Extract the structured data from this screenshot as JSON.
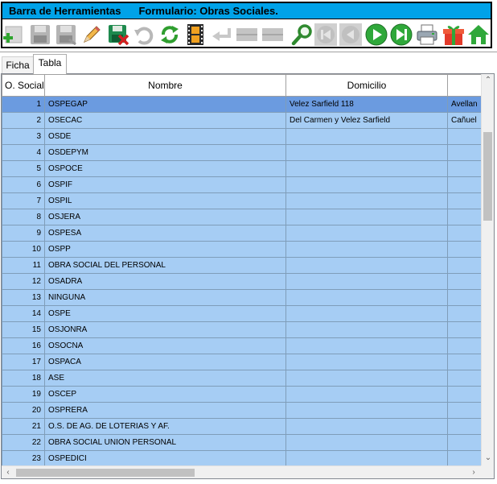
{
  "toolbar": {
    "title_left": "Barra de Herramientas",
    "title_right": "Formulario: Obras Sociales.",
    "title_color": "#00a2e8",
    "buttons": [
      {
        "icon": "add-icon",
        "enabled": true
      },
      {
        "icon": "save-icon",
        "enabled": false
      },
      {
        "icon": "save-as-icon",
        "enabled": false
      },
      {
        "icon": "edit-pencil-icon",
        "enabled": true
      },
      {
        "icon": "delete-save-icon",
        "enabled": true
      },
      {
        "icon": "undo-icon",
        "enabled": false
      },
      {
        "icon": "refresh-icon",
        "enabled": true
      },
      {
        "icon": "film-strip-icon",
        "enabled": true
      },
      {
        "icon": "return-arrow-icon",
        "enabled": false
      },
      {
        "icon": "bar-icon",
        "enabled": false
      },
      {
        "icon": "bar-icon",
        "enabled": false
      },
      {
        "icon": "search-icon",
        "enabled": true
      },
      {
        "icon": "first-record-icon",
        "enabled": false
      },
      {
        "icon": "previous-record-icon",
        "enabled": false
      },
      {
        "icon": "next-record-icon",
        "enabled": true
      },
      {
        "icon": "last-record-icon",
        "enabled": true
      },
      {
        "icon": "printer-icon",
        "enabled": true
      },
      {
        "icon": "gift-icon",
        "enabled": true
      },
      {
        "icon": "home-icon",
        "enabled": true
      }
    ]
  },
  "tabs": [
    {
      "label": "Ficha",
      "active": false
    },
    {
      "label": "Tabla",
      "active": true
    }
  ],
  "grid": {
    "columns": [
      "O. Social",
      "Nombre",
      "Domicilio",
      ""
    ],
    "selected_row": 0,
    "row_color": "#a6cdf4",
    "selected_color": "#6b9be0",
    "rows": [
      [
        "1",
        "OSPEGAP",
        "Velez Sarfield 118",
        "Avellan"
      ],
      [
        "2",
        "OSECAC",
        "Del Carmen y Velez Sarfield",
        "Cañuel"
      ],
      [
        "3",
        "OSDE",
        "",
        ""
      ],
      [
        "4",
        "OSDEPYM",
        "",
        ""
      ],
      [
        "5",
        "OSPOCE",
        "",
        ""
      ],
      [
        "6",
        "OSPIF",
        "",
        ""
      ],
      [
        "7",
        "OSPIL",
        "",
        ""
      ],
      [
        "8",
        "OSJERA",
        "",
        ""
      ],
      [
        "9",
        "OSPESA",
        "",
        ""
      ],
      [
        "10",
        "OSPP",
        "",
        ""
      ],
      [
        "11",
        "OBRA SOCIAL DEL PERSONAL",
        "",
        ""
      ],
      [
        "12",
        "OSADRA",
        "",
        ""
      ],
      [
        "13",
        "NINGUNA",
        "",
        ""
      ],
      [
        "14",
        "OSPE",
        "",
        ""
      ],
      [
        "15",
        "OSJONRA",
        "",
        ""
      ],
      [
        "16",
        "OSOCNA",
        "",
        ""
      ],
      [
        "17",
        "OSPACA",
        "",
        ""
      ],
      [
        "18",
        "ASE",
        "",
        ""
      ],
      [
        "19",
        "OSCEP",
        "",
        ""
      ],
      [
        "20",
        "OSPRERA",
        "",
        ""
      ],
      [
        "21",
        "O.S. DE AG. DE LOTERIAS Y AF.",
        "",
        ""
      ],
      [
        "22",
        "OBRA SOCIAL UNION PERSONAL",
        "",
        ""
      ],
      [
        "23",
        "OSPEDICI",
        "",
        ""
      ]
    ]
  }
}
